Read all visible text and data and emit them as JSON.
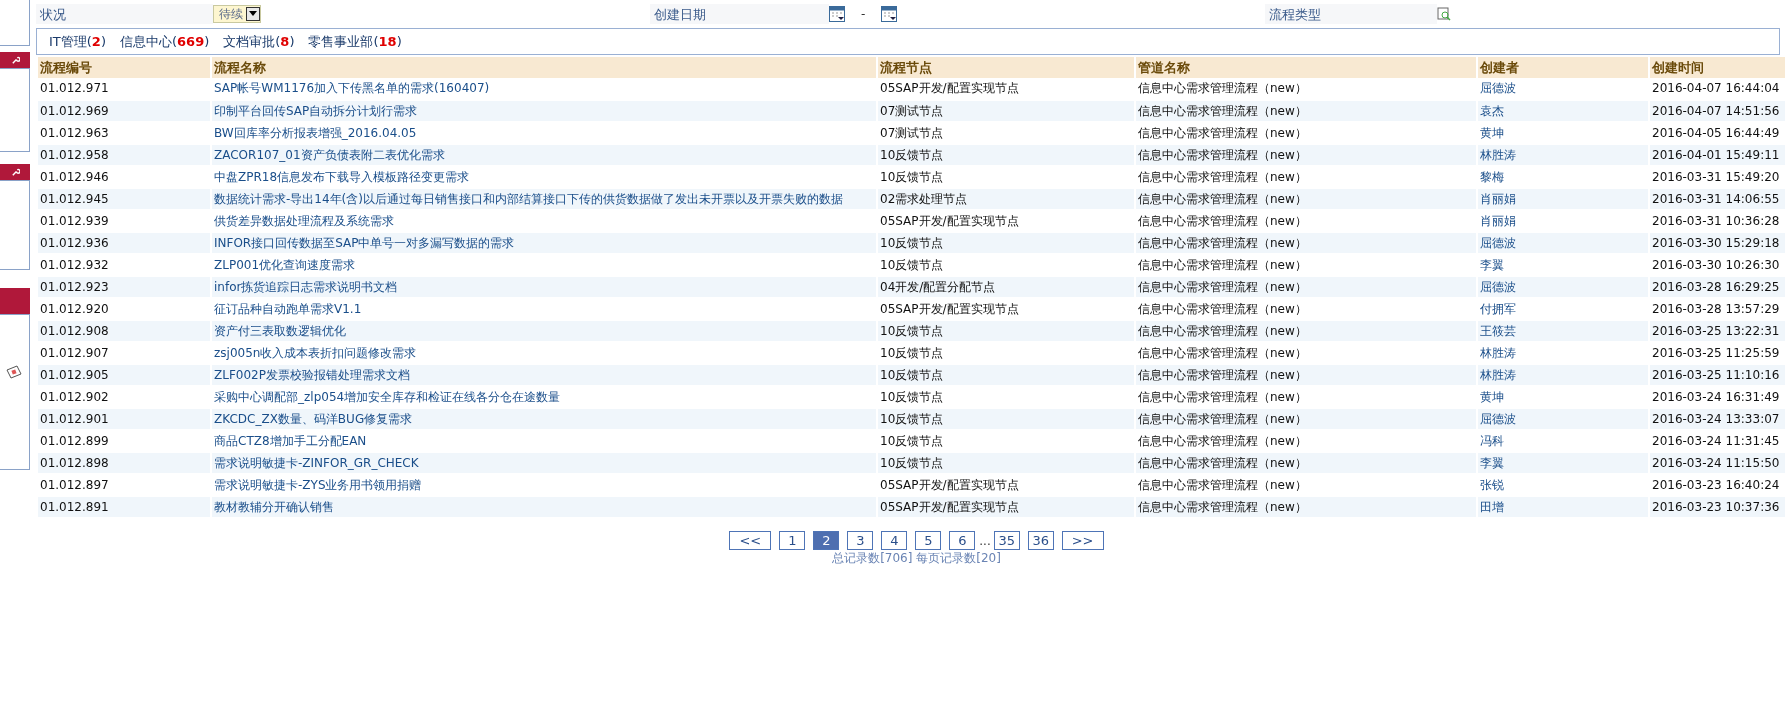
{
  "filters": {
    "status_label": "状况",
    "status_value": "待续",
    "date_label": "创建日期",
    "date_separator": "-",
    "type_label": "流程类型"
  },
  "tabs": [
    {
      "label": "IT管理(**2**)"
    },
    {
      "label": "信息中心(**669**)"
    },
    {
      "label": "文档审批(**8**)"
    },
    {
      "label": "零售事业部(**18**)"
    }
  ],
  "table": {
    "columns": [
      "流程编号",
      "流程名称",
      "流程节点",
      "管道名称",
      "创建者",
      "创建时间"
    ],
    "rows": [
      {
        "id": "01.012.971",
        "name": "SAP帐号WM1176加入下传黑名单的需求(160407)",
        "node": "05SAP开发/配置实现节点",
        "pipeline": "信息中心需求管理流程（new）",
        "creator": "屈德波",
        "time": "2016-04-07 16:44:04"
      },
      {
        "id": "01.012.969",
        "name": "印制平台回传SAP自动拆分计划行需求",
        "node": "07测试节点",
        "pipeline": "信息中心需求管理流程（new）",
        "creator": "袁杰",
        "time": "2016-04-07 14:51:56"
      },
      {
        "id": "01.012.963",
        "name": "BW回库率分析报表增强_2016.04.05",
        "node": "07测试节点",
        "pipeline": "信息中心需求管理流程（new）",
        "creator": "黄坤",
        "time": "2016-04-05 16:44:49"
      },
      {
        "id": "01.012.958",
        "name": "ZACOR107_01资产负债表附二表优化需求",
        "node": "10反馈节点",
        "pipeline": "信息中心需求管理流程（new）",
        "creator": "林胜涛",
        "time": "2016-04-01 15:49:11"
      },
      {
        "id": "01.012.946",
        "name": "中盘ZPR18信息发布下载导入模板路径变更需求",
        "node": "10反馈节点",
        "pipeline": "信息中心需求管理流程（new）",
        "creator": "黎梅",
        "time": "2016-03-31 15:49:20"
      },
      {
        "id": "01.012.945",
        "name": "数据统计需求-导出14年(含)以后通过每日销售接口和内部结算接口下传的供货数据做了发出未开票以及开票失败的数据",
        "node": "02需求处理节点",
        "pipeline": "信息中心需求管理流程（new）",
        "creator": "肖丽娟",
        "time": "2016-03-31 14:06:55"
      },
      {
        "id": "01.012.939",
        "name": "供货差异数据处理流程及系统需求",
        "node": "05SAP开发/配置实现节点",
        "pipeline": "信息中心需求管理流程（new）",
        "creator": "肖丽娟",
        "time": "2016-03-31 10:36:28"
      },
      {
        "id": "01.012.936",
        "name": "INFOR接口回传数据至SAP中单号一对多漏写数据的需求",
        "node": "10反馈节点",
        "pipeline": "信息中心需求管理流程（new）",
        "creator": "屈德波",
        "time": "2016-03-30 15:29:18"
      },
      {
        "id": "01.012.932",
        "name": "ZLP001优化查询速度需求",
        "node": "10反馈节点",
        "pipeline": "信息中心需求管理流程（new）",
        "creator": "李翼",
        "time": "2016-03-30 10:26:30"
      },
      {
        "id": "01.012.923",
        "name": "infor拣货追踪日志需求说明书文档",
        "node": "04开发/配置分配节点",
        "pipeline": "信息中心需求管理流程（new）",
        "creator": "屈德波",
        "time": "2016-03-28 16:29:25"
      },
      {
        "id": "01.012.920",
        "name": "征订品种自动跑单需求V1.1",
        "node": "05SAP开发/配置实现节点",
        "pipeline": "信息中心需求管理流程（new）",
        "creator": "付拥军",
        "time": "2016-03-28 13:57:29"
      },
      {
        "id": "01.012.908",
        "name": "资产付三表取数逻辑优化",
        "node": "10反馈节点",
        "pipeline": "信息中心需求管理流程（new）",
        "creator": "王筱芸",
        "time": "2016-03-25 13:22:31"
      },
      {
        "id": "01.012.907",
        "name": "zsj005n收入成本表折扣问题修改需求",
        "node": "10反馈节点",
        "pipeline": "信息中心需求管理流程（new）",
        "creator": "林胜涛",
        "time": "2016-03-25 11:25:59"
      },
      {
        "id": "01.012.905",
        "name": "ZLF002P发票校验报错处理需求文档",
        "node": "10反馈节点",
        "pipeline": "信息中心需求管理流程（new）",
        "creator": "林胜涛",
        "time": "2016-03-25 11:10:16"
      },
      {
        "id": "01.012.902",
        "name": "采购中心调配部_zlp054增加安全库存和检证在线各分仓在途数量",
        "node": "10反馈节点",
        "pipeline": "信息中心需求管理流程（new）",
        "creator": "黄坤",
        "time": "2016-03-24 16:31:49"
      },
      {
        "id": "01.012.901",
        "name": "ZKCDC_ZX数量、码洋BUG修复需求",
        "node": "10反馈节点",
        "pipeline": "信息中心需求管理流程（new）",
        "creator": "屈德波",
        "time": "2016-03-24 13:33:07"
      },
      {
        "id": "01.012.899",
        "name": "商品CTZ8增加手工分配EAN",
        "node": "10反馈节点",
        "pipeline": "信息中心需求管理流程（new）",
        "creator": "冯科",
        "time": "2016-03-24 11:31:45"
      },
      {
        "id": "01.012.898",
        "name": "需求说明敏捷卡-ZINFOR_GR_CHECK",
        "node": "10反馈节点",
        "pipeline": "信息中心需求管理流程（new）",
        "creator": "李翼",
        "time": "2016-03-24 11:15:50"
      },
      {
        "id": "01.012.897",
        "name": "需求说明敏捷卡-ZYS业务用书领用捐赠",
        "node": "05SAP开发/配置实现节点",
        "pipeline": "信息中心需求管理流程（new）",
        "creator": "张锐",
        "time": "2016-03-23 16:40:24"
      },
      {
        "id": "01.012.891",
        "name": "教材教辅分开确认销售",
        "node": "05SAP开发/配置实现节点",
        "pipeline": "信息中心需求管理流程（new）",
        "creator": "田增",
        "time": "2016-03-23 10:37:36"
      }
    ]
  },
  "pagination": {
    "pages": [
      {
        "label": "<<",
        "kind": "nav"
      },
      {
        "label": "1",
        "kind": "page",
        "selected": false
      },
      {
        "label": "2",
        "kind": "page",
        "selected": true
      },
      {
        "label": "3",
        "kind": "page",
        "selected": false
      },
      {
        "label": "4",
        "kind": "page",
        "selected": false
      },
      {
        "label": "5",
        "kind": "page",
        "selected": false
      },
      {
        "label": "6",
        "kind": "page",
        "selected": false
      },
      {
        "label": "...",
        "kind": "gap"
      },
      {
        "label": "35",
        "kind": "page",
        "selected": false
      },
      {
        "label": "36",
        "kind": "page",
        "selected": false
      },
      {
        "label": ">>",
        "kind": "nav"
      }
    ],
    "summary": "总记录数[706] 每页记录数[20]"
  }
}
